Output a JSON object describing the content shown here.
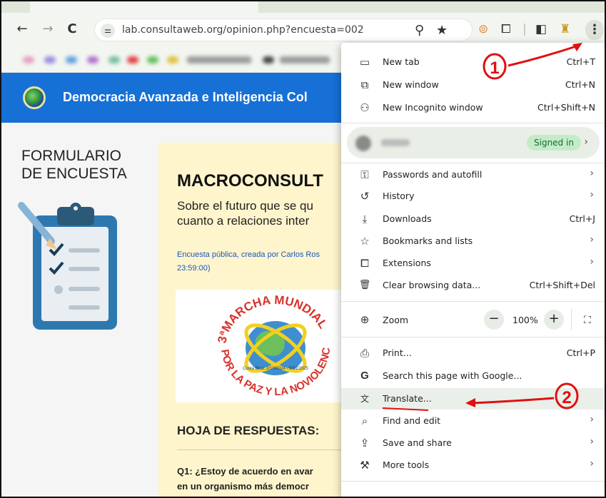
{
  "browser": {
    "url": "lab.consultaweb.org/opinion.php?encuesta=002",
    "nav": {
      "back": "←",
      "forward": "→",
      "reload": "C"
    },
    "site_info_glyph": "⚌",
    "icons": [
      "location-pin-icon",
      "star-icon",
      "reading-icon",
      "extensions-icon",
      "side-panel-icon",
      "profile-icon",
      "kebab-menu-icon"
    ],
    "kebab_glyph": "⋮"
  },
  "site": {
    "title": "Democracia Avanzada e Inteligencia Col"
  },
  "page": {
    "side_title_line1": "FORMULARIO",
    "side_title_line2": "DE ENCUESTA",
    "card_title": "MACROCONSULT",
    "card_subtitle_line1": "Sobre el futuro que se qu",
    "card_subtitle_line2": "cuanto a relaciones inter",
    "meta_line1": "Encuesta pública, creada por Carlos Ros",
    "meta_line2": "23:59:00)",
    "march_text_top": "3ªMARCHA MUNDIAL",
    "march_text_bottom": "POR LA PAZ Y LA NOVIOLENCIA",
    "march_small": "Costa Rica: 2/10/2024 - 5/01/2025",
    "answers_title": "HOJA DE RESPUESTAS:",
    "q1_line1": "Q1: ¿Estoy de acuerdo en avar",
    "q1_line2": "en un organismo más democr"
  },
  "menu": {
    "items": [
      {
        "label": "New tab",
        "shortcut": "Ctrl+T",
        "icon": "new-tab-icon",
        "glyph": "▭"
      },
      {
        "label": "New window",
        "shortcut": "Ctrl+N",
        "icon": "new-window-icon",
        "glyph": "⧉"
      },
      {
        "label": "New Incognito window",
        "shortcut": "Ctrl+Shift+N",
        "icon": "incognito-icon",
        "glyph": "⚇"
      }
    ],
    "profile": {
      "signed_in": "Signed in",
      "arrow": "›"
    },
    "items2": [
      {
        "label": "Passwords and autofill",
        "arrow": "›",
        "icon": "key-icon",
        "glyph": "⚿"
      },
      {
        "label": "History",
        "arrow": "›",
        "icon": "history-icon",
        "glyph": "↺"
      },
      {
        "label": "Downloads",
        "shortcut": "Ctrl+J",
        "icon": "download-icon",
        "glyph": "⤓"
      },
      {
        "label": "Bookmarks and lists",
        "arrow": "›",
        "icon": "star-outline-icon",
        "glyph": "☆"
      },
      {
        "label": "Extensions",
        "arrow": "›",
        "icon": "puzzle-icon",
        "glyph": "⧠"
      },
      {
        "label": "Clear browsing data...",
        "shortcut": "Ctrl+Shift+Del",
        "icon": "trash-icon",
        "glyph": "🗑"
      }
    ],
    "zoom": {
      "label": "Zoom",
      "minus": "−",
      "value": "100%",
      "plus": "+",
      "icon": "zoom-icon",
      "glyph": "⊕",
      "fullscreen_glyph": "⛶"
    },
    "items3": [
      {
        "label": "Print...",
        "shortcut": "Ctrl+P",
        "icon": "print-icon",
        "glyph": "⎙"
      },
      {
        "label": "Search this page with Google...",
        "icon": "google-icon",
        "glyph": "G"
      },
      {
        "label": "Translate...",
        "icon": "translate-icon",
        "glyph": "文"
      },
      {
        "label": "Find and edit",
        "arrow": "›",
        "icon": "find-icon",
        "glyph": "⌕"
      },
      {
        "label": "Save and share",
        "arrow": "›",
        "icon": "save-share-icon",
        "glyph": "⇪"
      },
      {
        "label": "More tools",
        "arrow": "›",
        "icon": "toolbox-icon",
        "glyph": "⚒"
      }
    ]
  },
  "annotations": {
    "one": "1",
    "two": "2"
  },
  "colors": {
    "header_blue": "#1670d6",
    "card_yellow": "#fff5cc",
    "annotation_red": "#e01010",
    "signed_green": "#c4ebc8"
  }
}
